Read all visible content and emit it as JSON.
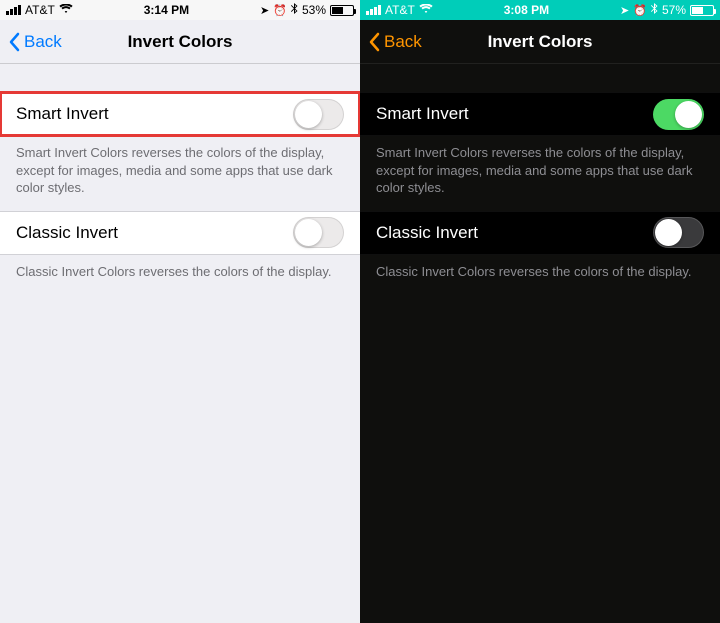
{
  "left": {
    "status": {
      "carrier": "AT&T",
      "time": "3:14 PM",
      "battery_pct": "53%",
      "battery_fill_pct": 53
    },
    "nav": {
      "back": "Back",
      "title": "Invert Colors"
    },
    "smart": {
      "label": "Smart Invert",
      "on": false,
      "highlighted": true,
      "desc": "Smart Invert Colors reverses the colors of the display, except for images, media and some apps that use dark color styles."
    },
    "classic": {
      "label": "Classic Invert",
      "on": false,
      "desc": "Classic Invert Colors reverses the colors of the display."
    }
  },
  "right": {
    "status": {
      "carrier": "AT&T",
      "time": "3:08 PM",
      "battery_pct": "57%",
      "battery_fill_pct": 57
    },
    "nav": {
      "back": "Back",
      "title": "Invert Colors"
    },
    "smart": {
      "label": "Smart Invert",
      "on": true,
      "highlighted": false,
      "desc": "Smart Invert Colors reverses the colors of the display, except for images, media and some apps that use dark color styles."
    },
    "classic": {
      "label": "Classic Invert",
      "on": false,
      "desc": "Classic Invert Colors reverses the colors of the display."
    }
  }
}
